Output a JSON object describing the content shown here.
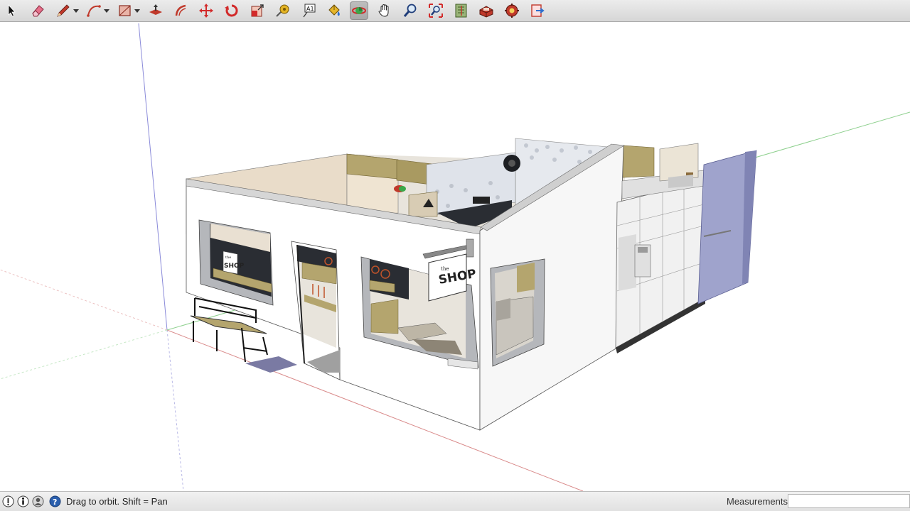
{
  "toolbar": {
    "tools": [
      {
        "id": "select",
        "icon": "select-arrow-icon"
      },
      {
        "id": "eraser",
        "icon": "eraser-icon"
      },
      {
        "id": "line",
        "icon": "pencil-line-icon"
      },
      {
        "id": "arc",
        "icon": "arc-icon"
      },
      {
        "id": "shape",
        "icon": "rectangle-shape-icon"
      },
      {
        "id": "push-pull",
        "icon": "push-pull-icon"
      },
      {
        "id": "offset",
        "icon": "offset-icon"
      },
      {
        "id": "move",
        "icon": "move-icon"
      },
      {
        "id": "rotate",
        "icon": "rotate-icon"
      },
      {
        "id": "scale",
        "icon": "scale-icon"
      },
      {
        "id": "tape",
        "icon": "tape-measure-icon"
      },
      {
        "id": "text",
        "icon": "text-label-icon"
      },
      {
        "id": "paint",
        "icon": "paint-bucket-icon"
      },
      {
        "id": "orbit",
        "icon": "orbit-icon"
      },
      {
        "id": "pan",
        "icon": "pan-hand-icon"
      },
      {
        "id": "zoom",
        "icon": "zoom-magnifier-icon"
      },
      {
        "id": "zoom-extents",
        "icon": "zoom-extents-icon"
      },
      {
        "id": "warehouse",
        "icon": "3d-warehouse-icon"
      },
      {
        "id": "extension-warehouse",
        "icon": "extension-warehouse-icon"
      },
      {
        "id": "extension-manager",
        "icon": "extension-manager-icon"
      },
      {
        "id": "send-to-layout",
        "icon": "send-to-layout-icon"
      }
    ],
    "active_tool": "orbit",
    "text_tool_glyph": "A1"
  },
  "model": {
    "sign_small_word": "the",
    "sign_big_word": "SHOP",
    "window_sign_small": "the",
    "window_sign_big": "SHOP"
  },
  "status": {
    "hint": "Drag to orbit.  Shift = Pan",
    "measurements_label": "Measurements",
    "measurements_value": ""
  },
  "colors": {
    "axis_red": "#d98a8a",
    "axis_green": "#8ed08e",
    "axis_blue": "#8a8ad9",
    "wall": "#ffffff",
    "wood": "#b4a56e",
    "door_blue": "#9fa3cc",
    "dark_wall": "#2a2d33"
  }
}
